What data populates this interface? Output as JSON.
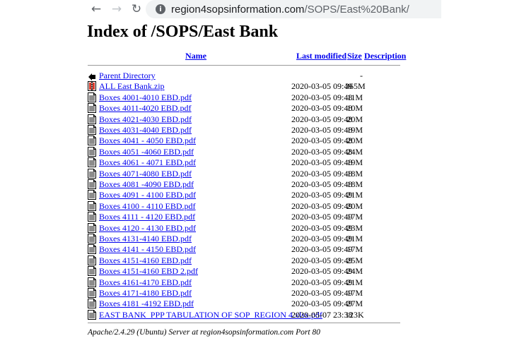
{
  "browser": {
    "back_label": "←",
    "forward_label": "→",
    "reload_label": "↻",
    "info_label": "i",
    "url_host": "region4sopsinformation.com",
    "url_path": "/SOPS/East%20Bank/"
  },
  "page": {
    "title": "Index of /SOPS/East Bank",
    "footer": "Apache/2.4.29 (Ubuntu) Server at region4sopsinformation.com Port 80"
  },
  "table": {
    "headers": {
      "name": "Name",
      "last_modified": "Last modified",
      "size": "Size",
      "description": "Description"
    },
    "rows": [
      {
        "icon": "back-folder-icon",
        "name": "Parent Directory",
        "date": "",
        "size": "-"
      },
      {
        "icon": "zip-file-icon",
        "name": "ALL East Bank.zip",
        "date": "2020-03-05 09:49",
        "size": "365M"
      },
      {
        "icon": "pdf-file-icon",
        "name": "Boxes 4001-4010 EBD.pdf",
        "date": "2020-03-05 09:48",
        "size": "11M"
      },
      {
        "icon": "pdf-file-icon",
        "name": "Boxes 4011-4020 EBD.pdf",
        "date": "2020-03-05 09:48",
        "size": "10M"
      },
      {
        "icon": "pdf-file-icon",
        "name": "Boxes 4021-4030 EBD.pdf",
        "date": "2020-03-05 09:48",
        "size": "20M"
      },
      {
        "icon": "pdf-file-icon",
        "name": "Boxes 4031-4040 EBD.pdf",
        "date": "2020-03-05 09:48",
        "size": "19M"
      },
      {
        "icon": "pdf-file-icon",
        "name": "Boxes 4041 - 4050 EBD.pdf",
        "date": "2020-03-05 09:48",
        "size": "20M"
      },
      {
        "icon": "pdf-file-icon",
        "name": "Boxes 4051 -4060 EBD.pdf",
        "date": "2020-03-05 09:48",
        "size": "24M"
      },
      {
        "icon": "pdf-file-icon",
        "name": "Boxes 4061 - 4071 EBD.pdf",
        "date": "2020-03-05 09:48",
        "size": "19M"
      },
      {
        "icon": "pdf-file-icon",
        "name": "Boxes 4071-4080 EBD.pdf",
        "date": "2020-03-05 09:48",
        "size": "18M"
      },
      {
        "icon": "pdf-file-icon",
        "name": "Boxes 4081 -4090 EBD.pdf",
        "date": "2020-03-05 09:48",
        "size": "18M"
      },
      {
        "icon": "pdf-file-icon",
        "name": "Boxes 4091 - 4100 EBD.pdf",
        "date": "2020-03-05 09:49",
        "size": "21M"
      },
      {
        "icon": "pdf-file-icon",
        "name": "Boxes 4100 - 4110 EBD.pdf",
        "date": "2020-03-05 09:49",
        "size": "20M"
      },
      {
        "icon": "pdf-file-icon",
        "name": "Boxes 4111 - 4120 EBD.pdf",
        "date": "2020-03-05 09:49",
        "size": "17M"
      },
      {
        "icon": "pdf-file-icon",
        "name": "Boxes 4120 - 4130 EBD.pdf",
        "date": "2020-03-05 09:49",
        "size": "23M"
      },
      {
        "icon": "pdf-file-icon",
        "name": "Boxes 4131-4140 EBD.pdf",
        "date": "2020-03-05 09:49",
        "size": "21M"
      },
      {
        "icon": "pdf-file-icon",
        "name": "Boxes 4141 - 4150 EBD.pdf",
        "date": "2020-03-05 09:49",
        "size": "17M"
      },
      {
        "icon": "pdf-file-icon",
        "name": "Boxes 4151-4160 EBD.pdf",
        "date": "2020-03-05 09:49",
        "size": "25M"
      },
      {
        "icon": "pdf-file-icon",
        "name": "Boxes 4151-4160 EBD 2.pdf",
        "date": "2020-03-05 09:49",
        "size": "24M"
      },
      {
        "icon": "pdf-file-icon",
        "name": "Boxes 4161-4170 EBD.pdf",
        "date": "2020-03-05 09:49",
        "size": "21M"
      },
      {
        "icon": "pdf-file-icon",
        "name": "Boxes 4171-4180 EBD.pdf",
        "date": "2020-03-05 09:49",
        "size": "17M"
      },
      {
        "icon": "pdf-file-icon",
        "name": "Boxes 4181 -4192 EBD.pdf",
        "date": "2020-03-05 09:49",
        "size": "27M"
      },
      {
        "icon": "pdf-file-icon",
        "name": "EAST BANK_PPP TABULATION OF SOP_REGION 4.xlsx.pdf",
        "date": "2020-05-07 23:38",
        "size": "123K"
      }
    ]
  }
}
